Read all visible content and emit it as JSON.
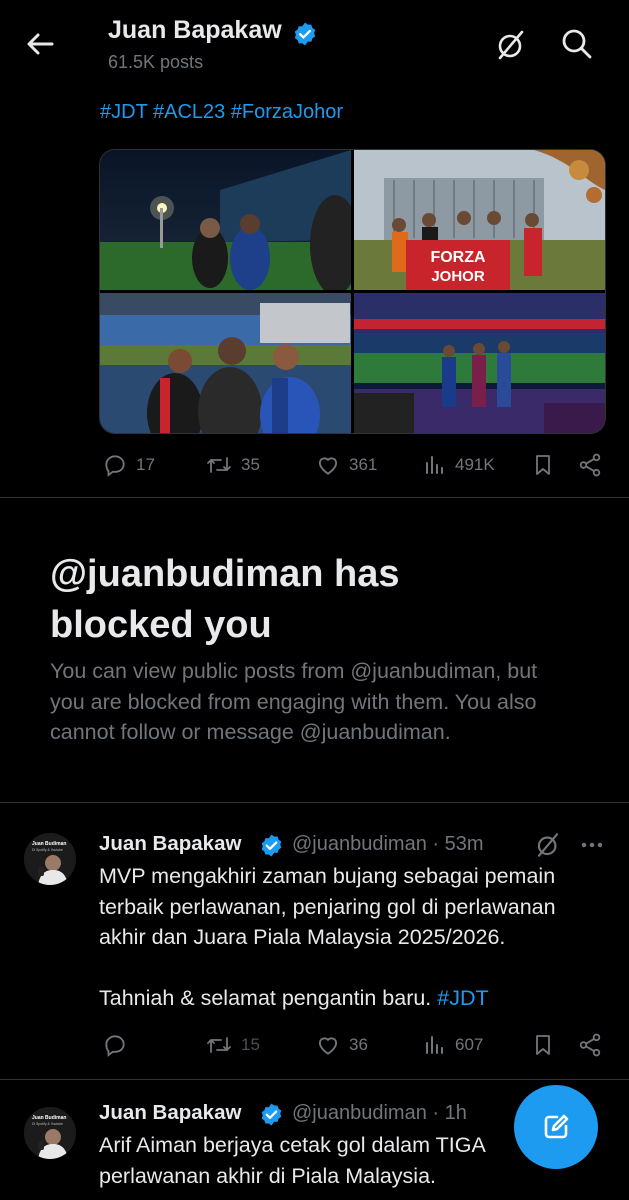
{
  "header": {
    "name": "Juan Bapakaw",
    "posts": "61.5K posts"
  },
  "pinned": {
    "hashtags": "#JDT #ACL23 #ForzaJohor",
    "photo_banner_text": [
      "FORZA",
      "JOHOR"
    ],
    "counts": {
      "replies": "17",
      "reposts": "35",
      "likes": "361",
      "views": "491K"
    }
  },
  "blocked": {
    "title_line1": "@juanbudiman has",
    "title_line2": "blocked you",
    "body_line1": "You can view public posts from @juanbudiman, but",
    "body_line2": "you are blocked from engaging with them. You also",
    "body_line3": "cannot follow or message @juanbudiman."
  },
  "tweets": [
    {
      "name": "Juan Bapakaw",
      "meta": "@juanbudiman · 53m",
      "lines": [
        "MVP mengakhiri zaman bujang sebagai pemain",
        "terbaik perlawanan, penjaring gol di perlawanan",
        "akhir dan Juara Piala Malaysia 2025/2026."
      ],
      "line4": "Tahniah & selamat pengantin baru. ",
      "hashtag": "#JDT",
      "counts": {
        "reposts": "15",
        "likes": "36",
        "views": "607"
      },
      "avatar_text": [
        "Juan Budiman",
        "Di Spotify & Youtube"
      ]
    },
    {
      "name": "Juan Bapakaw",
      "meta": "@juanbudiman · 1h",
      "lines": [
        "Arif Aiman berjaya cetak gol dalam TIGA",
        "perlawanan akhir di Piala Malaysia."
      ],
      "avatar_text": [
        "Juan Budiman",
        "Di Spotify & Youtube"
      ]
    }
  ],
  "colors": {
    "accent": "#1d9bf0",
    "background": "#000000",
    "text": "#e7e9ea",
    "muted": "#71767b",
    "divider": "#2f3336"
  }
}
